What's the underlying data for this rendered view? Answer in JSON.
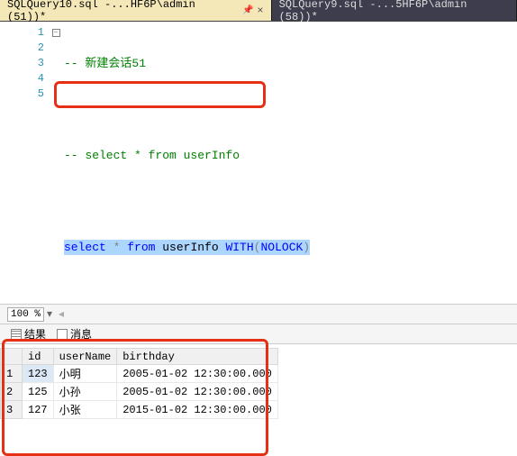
{
  "tabs": [
    {
      "label": "SQLQuery10.sql -...HF6P\\admin (51))*"
    },
    {
      "label": "SQLQuery9.sql -...5HF6P\\admin (58))*"
    }
  ],
  "code": {
    "l1_comment": "-- 新建会话51",
    "l3_comment": "-- select * from userInfo",
    "l5_select": "select",
    "l5_star": " * ",
    "l5_from": "from",
    "l5_table": " userInfo ",
    "l5_with": "WITH",
    "l5_paren_o": "(",
    "l5_nolock": "NOLOCK",
    "l5_paren_c": ")"
  },
  "line_numbers": [
    "1",
    "2",
    "3",
    "4",
    "5"
  ],
  "zoom": "100 %",
  "result_tabs": {
    "results": "结果",
    "messages": "消息"
  },
  "grid": {
    "headers": [
      "id",
      "userName",
      "birthday"
    ],
    "rows": [
      {
        "n": "1",
        "id": "123",
        "userName": "小明",
        "birthday": "2005-01-02 12:30:00.000"
      },
      {
        "n": "2",
        "id": "125",
        "userName": "小孙",
        "birthday": "2005-01-02 12:30:00.000"
      },
      {
        "n": "3",
        "id": "127",
        "userName": "小张",
        "birthday": "2015-01-02 12:30:00.000"
      }
    ]
  }
}
